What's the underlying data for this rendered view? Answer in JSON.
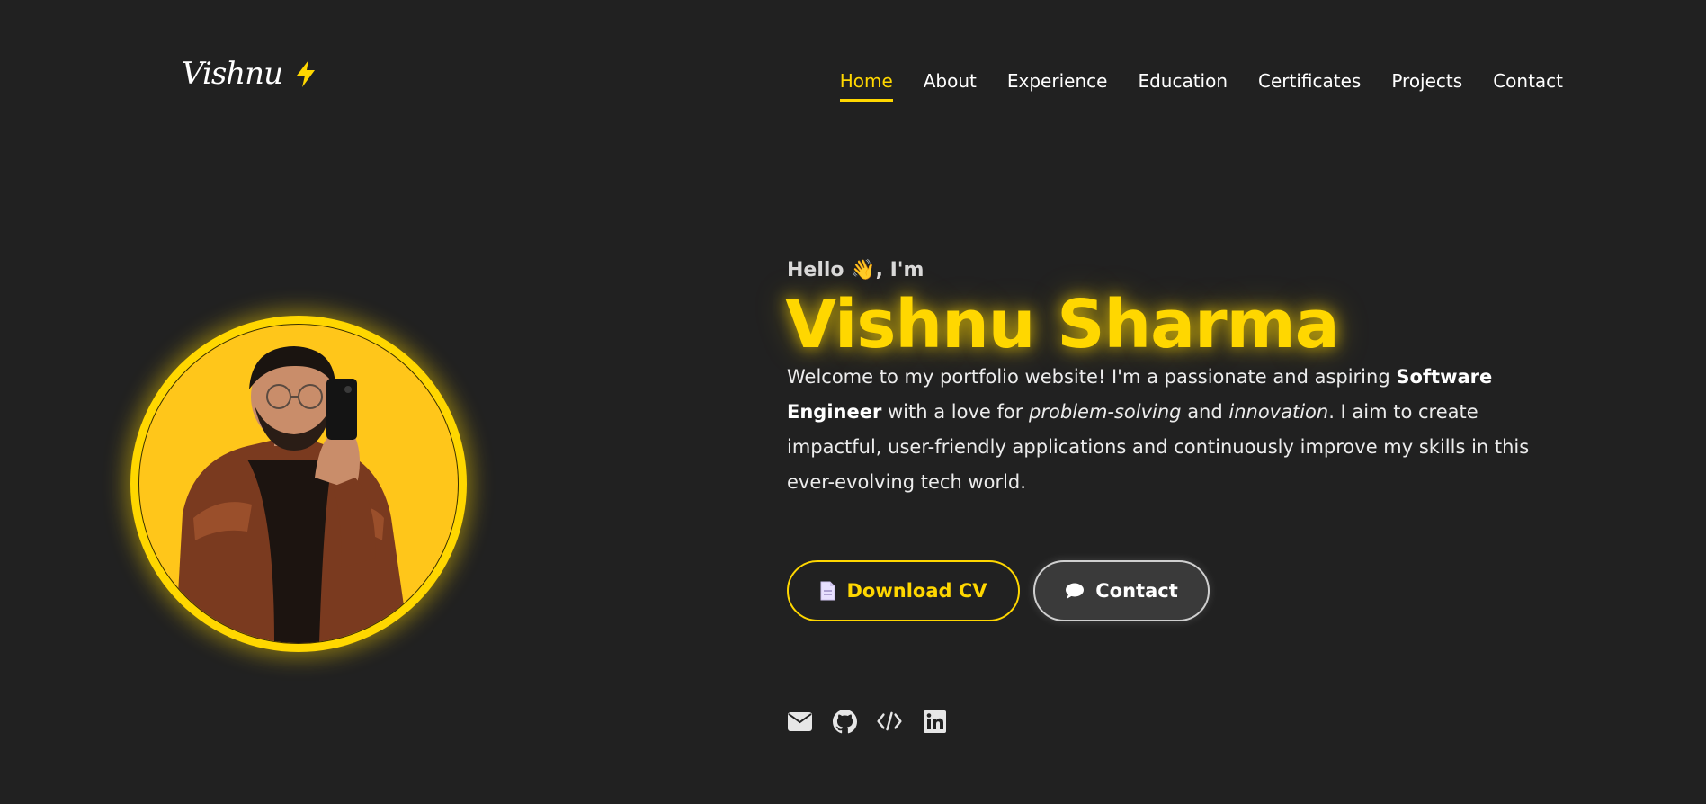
{
  "logo": {
    "text": "Vishnu",
    "icon": "lightning-bolt-icon"
  },
  "nav": {
    "items": [
      {
        "label": "Home",
        "active": true
      },
      {
        "label": "About",
        "active": false
      },
      {
        "label": "Experience",
        "active": false
      },
      {
        "label": "Education",
        "active": false
      },
      {
        "label": "Certificates",
        "active": false
      },
      {
        "label": "Projects",
        "active": false
      },
      {
        "label": "Contact",
        "active": false
      }
    ]
  },
  "hero": {
    "greeting_pre": "Hello",
    "greeting_emoji": "👋",
    "greeting_post": ", I'm",
    "name": "Vishnu Sharma",
    "bio": {
      "p1": "Welcome to my portfolio website! I'm a passionate and aspiring ",
      "b1": "Software Engineer",
      "p2": " with a love for ",
      "i1": "problem-solving",
      "p3": " and ",
      "i2": "innovation",
      "p4": ". I aim to create impactful, user-friendly applications and continuously improve my skills in this ever-evolving tech world."
    }
  },
  "buttons": {
    "download_cv": {
      "label": "Download CV",
      "icon": "document-icon"
    },
    "contact": {
      "label": "Contact",
      "icon": "chat-bubble-icon"
    }
  },
  "socials": [
    {
      "name": "email",
      "icon": "envelope-icon"
    },
    {
      "name": "github",
      "icon": "github-icon"
    },
    {
      "name": "code",
      "icon": "code-icon"
    },
    {
      "name": "linkedin",
      "icon": "linkedin-icon"
    }
  ],
  "colors": {
    "background": "#212121",
    "accent": "#ffd700",
    "text": "#ffffff"
  }
}
